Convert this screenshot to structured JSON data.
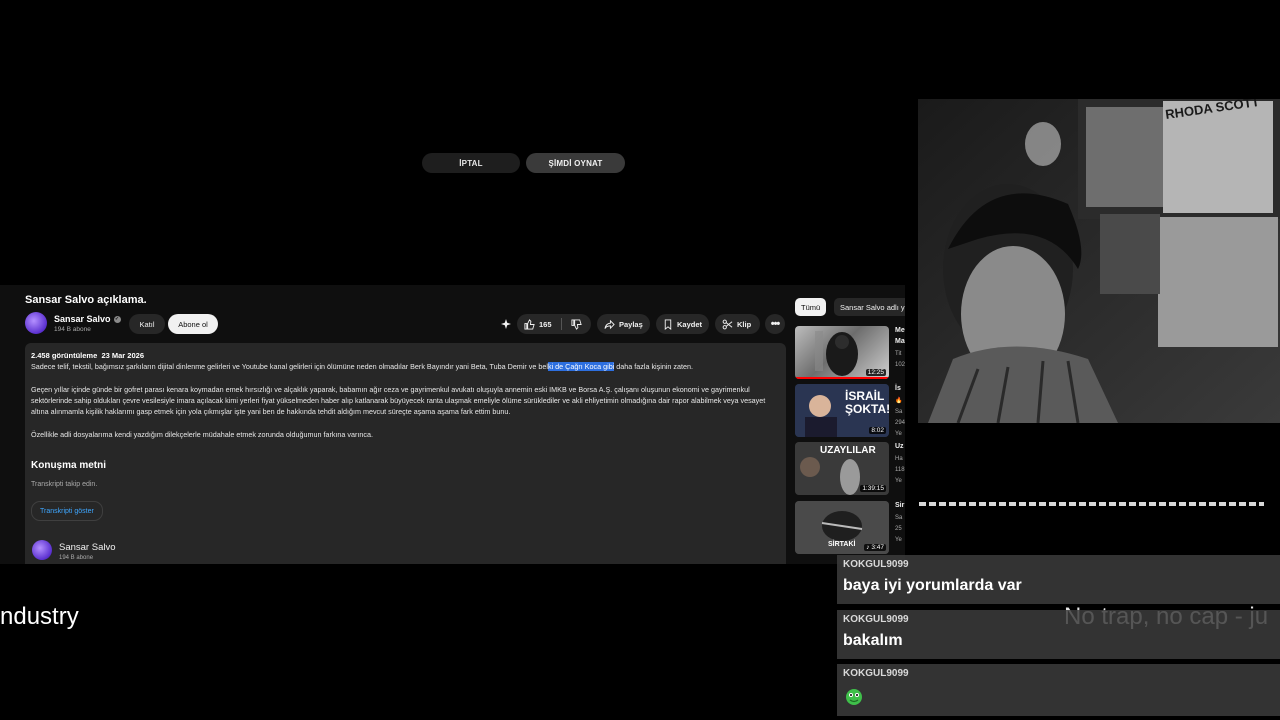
{
  "dialog": {
    "cancel_label": "İPTAL",
    "play_now_label": "ŞİMDİ OYNAT"
  },
  "video": {
    "title": "Sansar Salvo açıklama.",
    "channel": {
      "name": "Sansar Salvo",
      "subscribers": "194 B abone"
    },
    "join_label": "Katıl",
    "subscribe_label": "Abone ol",
    "like_count": "165",
    "share_label": "Paylaş",
    "save_label": "Kaydet",
    "clip_label": "Klip"
  },
  "description": {
    "views": "2.458 görüntüleme",
    "date": "23 Mar 2026",
    "p1_before": "Sadece telif, tekstil, bağımsız şarkıların dijital dinlenme gelirleri ve Youtube kanal gelirleri için ölümüne neden olmadılar Berk Bayındır yani Beta, Tuba Demir ve bel",
    "p1_highlight": "ki de Çağrı Koca gibi",
    "p1_after": " daha fazla kişinin zaten.",
    "p2": "Geçen yıllar içinde günde bir gofret parası kenara koymadan emek hırsızlığı ve alçaklık yaparak, babamın ağır ceza ve gayrimenkul avukatı oluşuyla annemin eski IMKB ve Borsa A.Ş. çalışanı oluşunun ekonomi ve gayrimenkul sektörlerinde sahip oldukları çevre vesilesiyle imara açılacak kimi yerleri fiyat yükselmeden haber alıp katlanarak büyüyecek ranta ulaşmak emeliyle ölüme sürüklediler ve akli ehliyetimin olmadığına dair rapor alabilmek veya vesayet altına alınmamla kişilik haklarımı gasp etmek için yola çıkmışlar işte yani ben de hakkında tehdit aldığım mevcut süreçte aşama aşama fark ettim bunu.",
    "p3": "Özellikle adli dosyalarıma kendi yazdığım dilekçelerle müdahale etmek zorunda olduğumun farkına varınca.",
    "transcript_title": "Konuşma metni",
    "transcript_sub": "Transkripti takip edin.",
    "transcript_button": "Transkripti göster",
    "channel_name": "Sansar Salvo",
    "channel_subs": "194 B abone"
  },
  "sidebar": {
    "chip_all": "Tümü",
    "chip_from": "Sansar Salvo adlı y",
    "items": [
      {
        "duration": "12:25",
        "title": "Me",
        "title2": "Ma",
        "meta1": "Tit",
        "meta2": "102"
      },
      {
        "duration": "8:02",
        "thumb_text": "İSRAİL ŞOKTA!",
        "title": "İs",
        "meta1": "Sa",
        "meta2": "294",
        "meta3": "Ye"
      },
      {
        "duration": "1:39:15",
        "thumb_text": "UZAYLILAR",
        "title": "Uz",
        "meta1": "Ha",
        "meta2": "118",
        "meta3": "Ye"
      },
      {
        "duration": "3:47",
        "thumb_text": "SİRTAKİ",
        "title": "Sir",
        "meta1": "Sa",
        "meta2": "25",
        "meta3": "Ye"
      }
    ]
  },
  "captions": {
    "left": "ndustry",
    "right": "No trap, no cap - ju"
  },
  "chat": [
    {
      "user": "KOKGUL9099",
      "text": "baya iyi yorumlarda var"
    },
    {
      "user": "KOKGUL9099",
      "text": "bakalım"
    },
    {
      "user": "KOKGUL9099",
      "text": "",
      "emote": "green-creature-emote"
    }
  ],
  "colors": {
    "accent_blue": "#3ea6ff",
    "highlight": "#2d6fdf",
    "background": "#0f0f0f"
  }
}
